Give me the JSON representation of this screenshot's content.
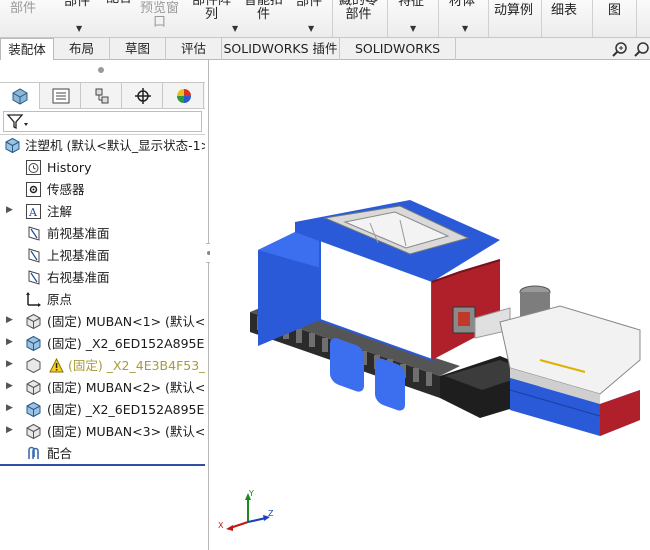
{
  "ribbon": {
    "commands": [
      {
        "label": "部件",
        "dim": true
      },
      {
        "label": "部件"
      },
      {
        "label": "配合"
      },
      {
        "label": "预览窗\n口",
        "dim": true
      },
      {
        "label": "部件阵\n列"
      },
      {
        "label": "智能扣\n件"
      },
      {
        "label": "部件"
      },
      {
        "label": "藏的零\n部件"
      },
      {
        "label": "特征"
      },
      {
        "label": "材体"
      },
      {
        "label": "动算例"
      },
      {
        "label": "细表"
      },
      {
        "label": "图"
      }
    ]
  },
  "tabs": [
    "装配体",
    "布局",
    "草图",
    "评估",
    "SOLIDWORKS 插件",
    "SOLIDWORKS MBD"
  ],
  "active_tab": "装配体",
  "tree": {
    "root": "注塑机  (默认<默认_显示状态-1>",
    "items": [
      {
        "label": "History",
        "icon": "history-icon",
        "expand": false
      },
      {
        "label": "传感器",
        "icon": "sensor-icon",
        "expand": false
      },
      {
        "label": "注解",
        "icon": "annotation-icon",
        "expand": true
      },
      {
        "label": "前视基准面",
        "icon": "plane-icon",
        "expand": false
      },
      {
        "label": "上视基准面",
        "icon": "plane-icon",
        "expand": false
      },
      {
        "label": "右视基准面",
        "icon": "plane-icon",
        "expand": false
      },
      {
        "label": "原点",
        "icon": "origin-icon",
        "expand": false
      },
      {
        "label": "(固定) MUBAN<1> (默认<<",
        "icon": "part-icon",
        "expand": true
      },
      {
        "label": "(固定) _X2_6ED152A895E8_X",
        "icon": "subassembly-icon",
        "expand": true
      },
      {
        "label": "(固定) _X2_4E3B4F53_X(",
        "icon": "warning-icon",
        "expand": true,
        "warn": true
      },
      {
        "label": "(固定) MUBAN<2> (默认<<",
        "icon": "part-icon",
        "expand": true
      },
      {
        "label": "(固定) _X2_6ED152A895E8_X",
        "icon": "subassembly-icon",
        "expand": true
      },
      {
        "label": "(固定) MUBAN<3> (默认<<",
        "icon": "part-icon",
        "expand": true
      },
      {
        "label": "配合",
        "icon": "mates-icon",
        "expand": false
      }
    ]
  },
  "triad": {
    "x": "X",
    "y": "Y",
    "z": "Z"
  }
}
